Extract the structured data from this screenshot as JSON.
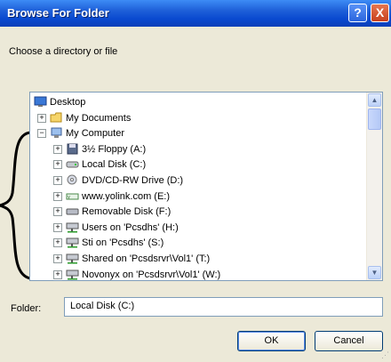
{
  "window": {
    "title": "Browse For Folder",
    "help": "?",
    "close": "X"
  },
  "prompt": "Choose a directory or file",
  "tree": {
    "items": [
      {
        "label": "Desktop",
        "icon": "desktop-icon",
        "expander": ""
      },
      {
        "label": "My Documents",
        "icon": "folder-icon",
        "expander": "+"
      },
      {
        "label": "My Computer",
        "icon": "computer-icon",
        "expander": "−"
      },
      {
        "label": "3½ Floppy (A:)",
        "icon": "floppy-icon",
        "expander": "+"
      },
      {
        "label": "Local Disk (C:)",
        "icon": "hard-disk-icon",
        "expander": "+"
      },
      {
        "label": "DVD/CD-RW Drive (D:)",
        "icon": "cd-drive-icon",
        "expander": "+"
      },
      {
        "label": "www.yolink.com (E:)",
        "icon": "usb-drive-icon",
        "expander": "+"
      },
      {
        "label": "Removable Disk (F:)",
        "icon": "removable-disk-icon",
        "expander": "+"
      },
      {
        "label": "Users on 'Pcsdhs' (H:)",
        "icon": "network-drive-icon",
        "expander": "+"
      },
      {
        "label": "Sti on 'Pcsdhs' (S:)",
        "icon": "network-drive-icon",
        "expander": "+"
      },
      {
        "label": "Shared on 'Pcsdsrvr\\Vol1' (T:)",
        "icon": "network-drive-icon",
        "expander": "+"
      },
      {
        "label": "Novonyx on 'Pcsdsrvr\\Vol1' (W:)",
        "icon": "network-drive-icon",
        "expander": "+"
      }
    ]
  },
  "folder": {
    "label": "Folder:",
    "value": "Local Disk (C:)"
  },
  "buttons": {
    "ok": "OK",
    "cancel": "Cancel"
  },
  "colors": {
    "titlebar": "#0a4ad0",
    "dialog": "#ece9d8"
  }
}
